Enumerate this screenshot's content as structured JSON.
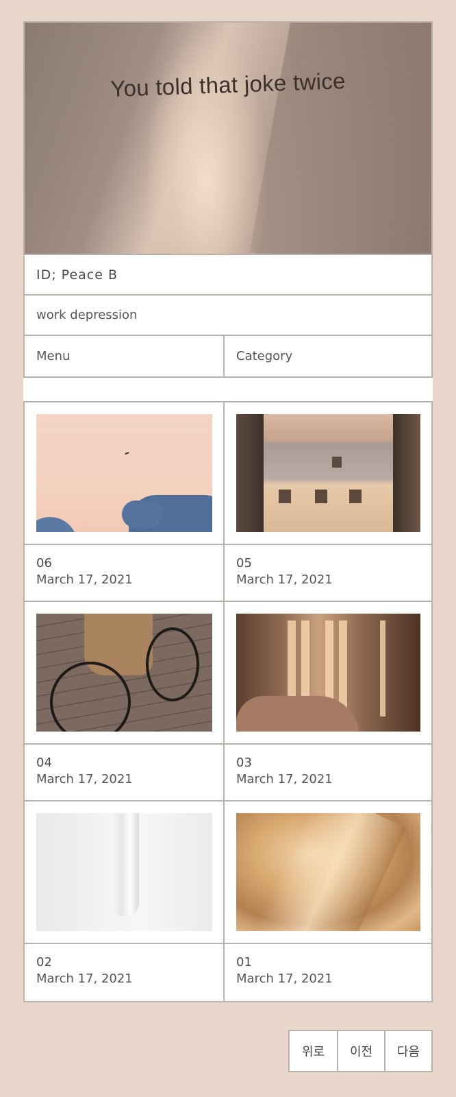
{
  "hero": {
    "caption": "You told that joke twice"
  },
  "blog": {
    "title": "ID; Peace B",
    "description": "work depression"
  },
  "nav": {
    "menu_label": "Menu",
    "category_label": "Category"
  },
  "posts": [
    {
      "number": "06",
      "date": "March 17, 2021"
    },
    {
      "number": "05",
      "date": "March 17, 2021"
    },
    {
      "number": "04",
      "date": "March 17, 2021"
    },
    {
      "number": "03",
      "date": "March 17, 2021"
    },
    {
      "number": "02",
      "date": "March 17, 2021"
    },
    {
      "number": "01",
      "date": "March 17, 2021"
    }
  ],
  "pagination": {
    "top_label": "위로",
    "prev_label": "이전",
    "next_label": "다음"
  }
}
